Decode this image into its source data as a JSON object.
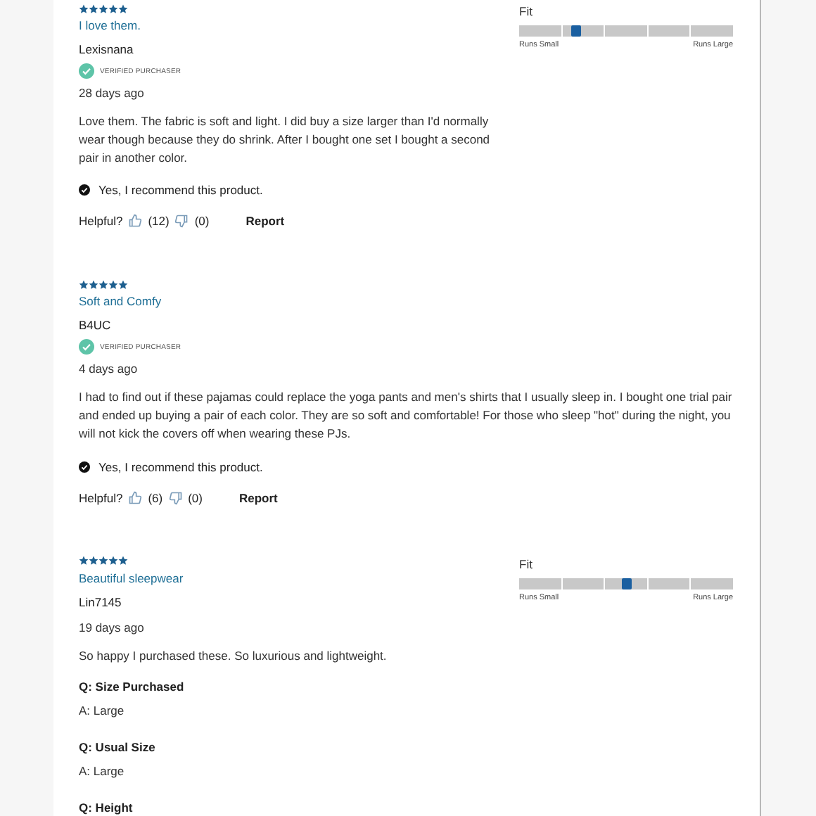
{
  "reviews": [
    {
      "stars": 5,
      "title": "I love them.",
      "author": "Lexisnana",
      "verified": true,
      "badge": "VERIFIED PURCHASER",
      "date": "28 days ago",
      "body": "Love them. The fabric is soft and light. I did buy a size larger than I'd normally wear though because they do shrink. After I bought one set I bought a second pair in another color.",
      "recommend": "Yes, I recommend this product.",
      "helpful_label": "Helpful?",
      "up_count": "(12)",
      "down_count": "(0)",
      "report": "Report",
      "fit": {
        "label": "Fit",
        "level": 0.26,
        "min_label": "Runs Small",
        "max_label": "Runs Large"
      }
    },
    {
      "stars": 5,
      "title": "Soft and Comfy",
      "author": "B4UC",
      "verified": true,
      "badge": "VERIFIED PURCHASER",
      "date": "4 days ago",
      "body": "I had to find out if these pajamas could replace the yoga pants and men's shirts that I usually sleep in. I bought one trial pair and ended up buying a pair of each color. They are so soft and comfortable! For those who sleep \"hot\" during the night, you will not kick the covers off when wearing these PJs.",
      "recommend": "Yes, I recommend this product.",
      "helpful_label": "Helpful?",
      "up_count": "(6)",
      "down_count": "(0)",
      "report": "Report"
    },
    {
      "stars": 5,
      "title": "Beautiful sleepwear",
      "author": "Lin7145",
      "date": "19 days ago",
      "body": "So happy I purchased these. So luxurious and lightweight.",
      "qa": [
        {
          "q": "Q: Size Purchased",
          "a": "A: Large"
        },
        {
          "q": "Q: Usual Size",
          "a": "A: Large"
        },
        {
          "q": "Q: Height"
        }
      ],
      "fit": {
        "label": "Fit",
        "level": 0.5,
        "min_label": "Runs Small",
        "max_label": "Runs Large"
      }
    }
  ]
}
